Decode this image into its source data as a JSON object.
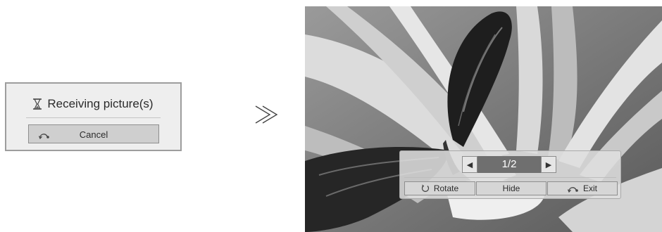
{
  "dialog": {
    "title": "Receiving picture(s)",
    "title_icon": "hourglass-icon",
    "cancel_label": "Cancel",
    "cancel_icon": "back-icon"
  },
  "transition": {
    "icon": "double-chevron-right-icon"
  },
  "viewer": {
    "page_indicator": "1/2",
    "prev_icon": "triangle-left-icon",
    "next_icon": "triangle-right-icon",
    "buttons": [
      {
        "label": "Rotate",
        "icon": "rotate-icon"
      },
      {
        "label": "Hide"
      },
      {
        "label": "Exit",
        "icon": "back-icon"
      }
    ]
  }
}
